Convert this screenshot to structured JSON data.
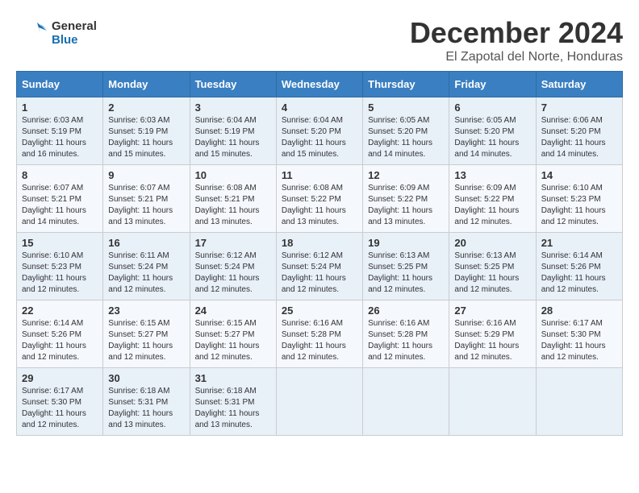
{
  "header": {
    "logo_line1": "General",
    "logo_line2": "Blue",
    "month_title": "December 2024",
    "location": "El Zapotal del Norte, Honduras"
  },
  "days_of_week": [
    "Sunday",
    "Monday",
    "Tuesday",
    "Wednesday",
    "Thursday",
    "Friday",
    "Saturday"
  ],
  "weeks": [
    [
      {
        "day": 1,
        "sunrise": "6:03 AM",
        "sunset": "5:19 PM",
        "daylight": "11 hours and 16 minutes."
      },
      {
        "day": 2,
        "sunrise": "6:03 AM",
        "sunset": "5:19 PM",
        "daylight": "11 hours and 15 minutes."
      },
      {
        "day": 3,
        "sunrise": "6:04 AM",
        "sunset": "5:19 PM",
        "daylight": "11 hours and 15 minutes."
      },
      {
        "day": 4,
        "sunrise": "6:04 AM",
        "sunset": "5:20 PM",
        "daylight": "11 hours and 15 minutes."
      },
      {
        "day": 5,
        "sunrise": "6:05 AM",
        "sunset": "5:20 PM",
        "daylight": "11 hours and 14 minutes."
      },
      {
        "day": 6,
        "sunrise": "6:05 AM",
        "sunset": "5:20 PM",
        "daylight": "11 hours and 14 minutes."
      },
      {
        "day": 7,
        "sunrise": "6:06 AM",
        "sunset": "5:20 PM",
        "daylight": "11 hours and 14 minutes."
      }
    ],
    [
      {
        "day": 8,
        "sunrise": "6:07 AM",
        "sunset": "5:21 PM",
        "daylight": "11 hours and 14 minutes."
      },
      {
        "day": 9,
        "sunrise": "6:07 AM",
        "sunset": "5:21 PM",
        "daylight": "11 hours and 13 minutes."
      },
      {
        "day": 10,
        "sunrise": "6:08 AM",
        "sunset": "5:21 PM",
        "daylight": "11 hours and 13 minutes."
      },
      {
        "day": 11,
        "sunrise": "6:08 AM",
        "sunset": "5:22 PM",
        "daylight": "11 hours and 13 minutes."
      },
      {
        "day": 12,
        "sunrise": "6:09 AM",
        "sunset": "5:22 PM",
        "daylight": "11 hours and 13 minutes."
      },
      {
        "day": 13,
        "sunrise": "6:09 AM",
        "sunset": "5:22 PM",
        "daylight": "11 hours and 12 minutes."
      },
      {
        "day": 14,
        "sunrise": "6:10 AM",
        "sunset": "5:23 PM",
        "daylight": "11 hours and 12 minutes."
      }
    ],
    [
      {
        "day": 15,
        "sunrise": "6:10 AM",
        "sunset": "5:23 PM",
        "daylight": "11 hours and 12 minutes."
      },
      {
        "day": 16,
        "sunrise": "6:11 AM",
        "sunset": "5:24 PM",
        "daylight": "11 hours and 12 minutes."
      },
      {
        "day": 17,
        "sunrise": "6:12 AM",
        "sunset": "5:24 PM",
        "daylight": "11 hours and 12 minutes."
      },
      {
        "day": 18,
        "sunrise": "6:12 AM",
        "sunset": "5:24 PM",
        "daylight": "11 hours and 12 minutes."
      },
      {
        "day": 19,
        "sunrise": "6:13 AM",
        "sunset": "5:25 PM",
        "daylight": "11 hours and 12 minutes."
      },
      {
        "day": 20,
        "sunrise": "6:13 AM",
        "sunset": "5:25 PM",
        "daylight": "11 hours and 12 minutes."
      },
      {
        "day": 21,
        "sunrise": "6:14 AM",
        "sunset": "5:26 PM",
        "daylight": "11 hours and 12 minutes."
      }
    ],
    [
      {
        "day": 22,
        "sunrise": "6:14 AM",
        "sunset": "5:26 PM",
        "daylight": "11 hours and 12 minutes."
      },
      {
        "day": 23,
        "sunrise": "6:15 AM",
        "sunset": "5:27 PM",
        "daylight": "11 hours and 12 minutes."
      },
      {
        "day": 24,
        "sunrise": "6:15 AM",
        "sunset": "5:27 PM",
        "daylight": "11 hours and 12 minutes."
      },
      {
        "day": 25,
        "sunrise": "6:16 AM",
        "sunset": "5:28 PM",
        "daylight": "11 hours and 12 minutes."
      },
      {
        "day": 26,
        "sunrise": "6:16 AM",
        "sunset": "5:28 PM",
        "daylight": "11 hours and 12 minutes."
      },
      {
        "day": 27,
        "sunrise": "6:16 AM",
        "sunset": "5:29 PM",
        "daylight": "11 hours and 12 minutes."
      },
      {
        "day": 28,
        "sunrise": "6:17 AM",
        "sunset": "5:30 PM",
        "daylight": "11 hours and 12 minutes."
      }
    ],
    [
      {
        "day": 29,
        "sunrise": "6:17 AM",
        "sunset": "5:30 PM",
        "daylight": "11 hours and 12 minutes."
      },
      {
        "day": 30,
        "sunrise": "6:18 AM",
        "sunset": "5:31 PM",
        "daylight": "11 hours and 13 minutes."
      },
      {
        "day": 31,
        "sunrise": "6:18 AM",
        "sunset": "5:31 PM",
        "daylight": "11 hours and 13 minutes."
      },
      null,
      null,
      null,
      null
    ]
  ],
  "labels": {
    "sunrise": "Sunrise:",
    "sunset": "Sunset:",
    "daylight": "Daylight:"
  }
}
